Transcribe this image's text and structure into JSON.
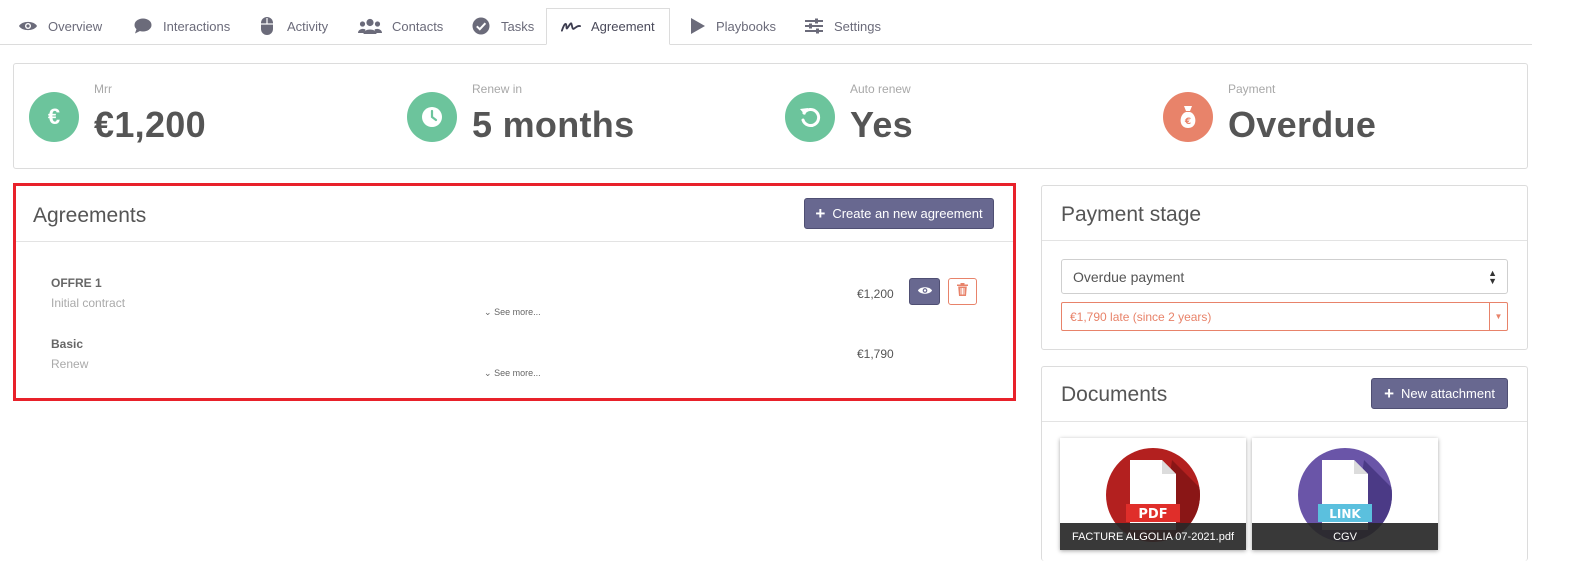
{
  "tabs": [
    {
      "label": "Overview",
      "icon": "eye-icon"
    },
    {
      "label": "Interactions",
      "icon": "chat-icon"
    },
    {
      "label": "Activity",
      "icon": "mouse-icon"
    },
    {
      "label": "Contacts",
      "icon": "users-icon"
    },
    {
      "label": "Tasks",
      "icon": "check-circle-icon"
    },
    {
      "label": "Agreement",
      "icon": "signature-icon",
      "active": true
    },
    {
      "label": "Playbooks",
      "icon": "play-icon"
    },
    {
      "label": "Settings",
      "icon": "sliders-icon"
    }
  ],
  "kpis": [
    {
      "label": "Mrr",
      "value": "€1,200",
      "icon": "euro-icon",
      "color": "#6cc49c"
    },
    {
      "label": "Renew in",
      "value": "5 months",
      "icon": "clock-icon",
      "color": "#6cc49c"
    },
    {
      "label": "Auto renew",
      "value": "Yes",
      "icon": "refresh-icon",
      "color": "#6cc49c"
    },
    {
      "label": "Payment",
      "value": "Overdue",
      "icon": "money-bag-icon",
      "color": "#e8836a"
    }
  ],
  "agreements": {
    "title": "Agreements",
    "create_label": "Create an new agreement",
    "rows": [
      {
        "name": "OFFRE 1",
        "subtitle": "Initial contract",
        "see_more": "See more...",
        "price": "€1,200"
      },
      {
        "name": "Basic",
        "subtitle": "Renew",
        "see_more": "See more...",
        "price": "€1,790"
      }
    ]
  },
  "payment_stage": {
    "title": "Payment stage",
    "selected": "Overdue payment",
    "late_text": "€1,790 late (since 2 years)"
  },
  "documents": {
    "title": "Documents",
    "new_label": "New attachment",
    "items": [
      {
        "name": "FACTURE ALGOLIA 07-2021.pdf",
        "type": "PDF",
        "color": "#b3201f"
      },
      {
        "name": "CGV",
        "type": "LINK",
        "color": "#6a55a8"
      }
    ]
  },
  "colors": {
    "accent": "#686890",
    "success": "#6cc49c",
    "warning": "#e8836a",
    "highlight": "#e8212a"
  }
}
